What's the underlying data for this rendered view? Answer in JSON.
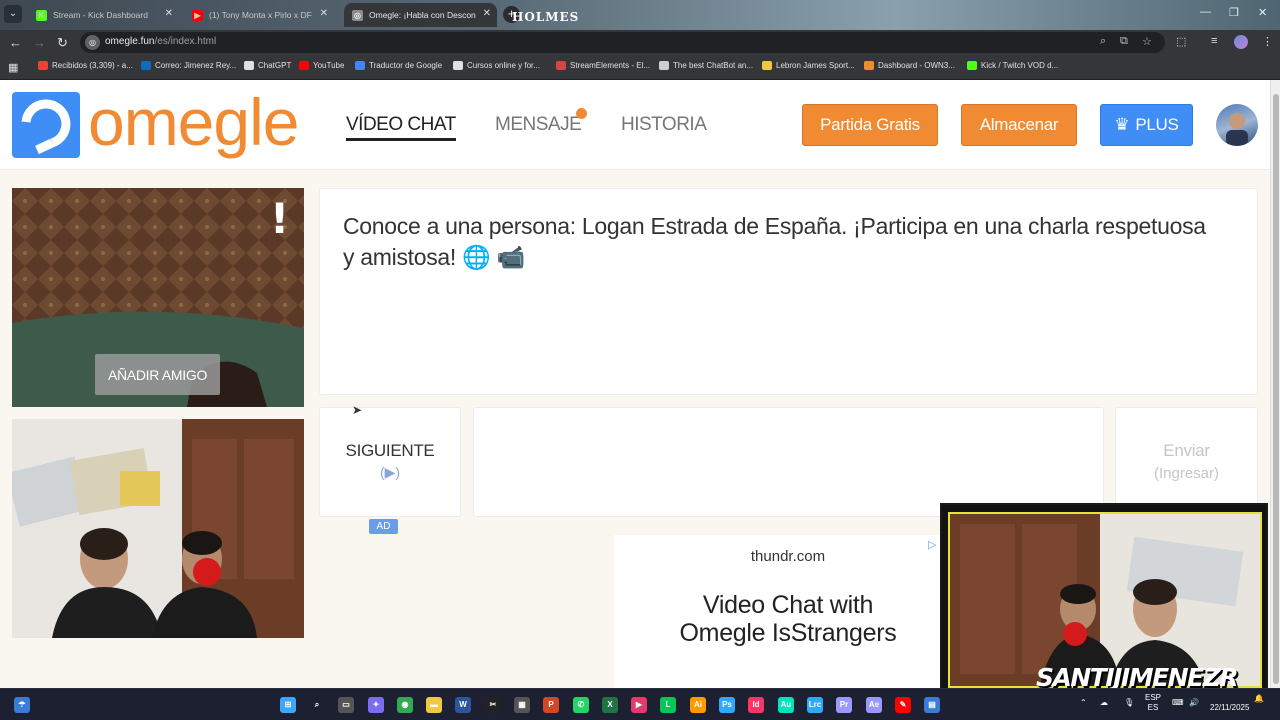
{
  "browser": {
    "tabs": [
      {
        "title": "Stream - Kick Dashboard",
        "active": false,
        "icon_color": "#53fc18",
        "icon": "K"
      },
      {
        "title": "(1) Tony Monta x Pirlo x DF",
        "active": false,
        "icon_color": "#ff0000",
        "icon": "▶"
      },
      {
        "title": "Omegle: ¡Habla con Descon",
        "active": true,
        "icon_color": "#8a8a8a",
        "icon": "◎"
      }
    ],
    "background_text": "HOLMES",
    "url_host": "omegle.fun",
    "url_path": "/es/index.html",
    "bookmarks": [
      {
        "label": "Recibidos (3,309) - a...",
        "color": "#ea4335"
      },
      {
        "label": "Correo: Jimenez Rey...",
        "color": "#0f6cbd"
      },
      {
        "label": "ChatGPT",
        "color": "#e0e0e0"
      },
      {
        "label": "YouTube",
        "color": "#ff0000"
      },
      {
        "label": "Traductor de Google",
        "color": "#4285f4"
      },
      {
        "label": "Cursos online y for...",
        "color": "#e0e0e0"
      },
      {
        "label": "StreamElements - El...",
        "color": "#d64545"
      },
      {
        "label": "The best ChatBot an...",
        "color": "#cfcfcf"
      },
      {
        "label": "Lebron James Sport...",
        "color": "#f2c744"
      },
      {
        "label": "Dashboard - OWN3...",
        "color": "#f08b34"
      },
      {
        "label": "Kick / Twitch VOD d...",
        "color": "#53fc18"
      }
    ]
  },
  "site": {
    "logo_text": "omegle",
    "nav": [
      {
        "label": "VÍDEO CHAT",
        "active": true
      },
      {
        "label": "MENSAJE",
        "active": false
      },
      {
        "label": "HISTORIA",
        "active": false
      }
    ],
    "buttons": {
      "free_match": "Partida Gratis",
      "store": "Almacenar",
      "plus": "PLUS"
    },
    "colors": {
      "accent": "#f08b34",
      "plus": "#3e8ef5",
      "logo_blue": "#3e8ef5"
    },
    "add_friend": "AÑADIR AMIGO",
    "report_icon": "!",
    "intro_message": "Conoce a una persona: Logan Estrada de España. ¡Participa en una charla respetuosa y amistosa! 🌐 📹",
    "next_label": "SIGUIENTE",
    "next_sub": "(▶)",
    "send_label": "Enviar",
    "send_sub": "(Ingresar)",
    "ad_badge": "AD",
    "ad": {
      "domain": "thundr.com",
      "title_line1": "Video Chat with",
      "title_line2": "Omegle IsStrangers"
    }
  },
  "overlay": {
    "name": "SANTIJIMENEZR"
  },
  "taskbar": {
    "language": "ESP",
    "language2": "ES",
    "date": "22/11/2025",
    "apps": [
      {
        "name": "start",
        "color": "#3ea6ff",
        "glyph": "⊞"
      },
      {
        "name": "search",
        "color": "#1c2030",
        "glyph": "⌕"
      },
      {
        "name": "task-view",
        "color": "#555",
        "glyph": "▭"
      },
      {
        "name": "copilot",
        "color": "#7b6cf0",
        "glyph": "✦"
      },
      {
        "name": "chrome",
        "color": "#34a853",
        "glyph": "◉"
      },
      {
        "name": "explorer",
        "color": "#f2c744",
        "glyph": "▬"
      },
      {
        "name": "word",
        "color": "#2b579a",
        "glyph": "W"
      },
      {
        "name": "capcut",
        "color": "#222",
        "glyph": "✂"
      },
      {
        "name": "calculator",
        "color": "#555",
        "glyph": "▦"
      },
      {
        "name": "powerpoint",
        "color": "#d24726",
        "glyph": "P"
      },
      {
        "name": "whatsapp",
        "color": "#25d366",
        "glyph": "✆"
      },
      {
        "name": "excel",
        "color": "#217346",
        "glyph": "X"
      },
      {
        "name": "media",
        "color": "#e23a6a",
        "glyph": "▶"
      },
      {
        "name": "line",
        "color": "#06c755",
        "glyph": "L"
      },
      {
        "name": "illustrator",
        "color": "#ff9a00",
        "glyph": "Ai"
      },
      {
        "name": "photoshop",
        "color": "#31a8ff",
        "glyph": "Ps"
      },
      {
        "name": "indesign",
        "color": "#ff3366",
        "glyph": "Id"
      },
      {
        "name": "audition",
        "color": "#00e4bb",
        "glyph": "Au"
      },
      {
        "name": "lightroom",
        "color": "#31a8ff",
        "glyph": "Lrc"
      },
      {
        "name": "premiere",
        "color": "#9999ff",
        "glyph": "Pr"
      },
      {
        "name": "after-effects",
        "color": "#9999ff",
        "glyph": "Ae"
      },
      {
        "name": "acrobat",
        "color": "#ff0000",
        "glyph": "✎"
      },
      {
        "name": "calc2",
        "color": "#3a7bd5",
        "glyph": "▤"
      }
    ]
  }
}
